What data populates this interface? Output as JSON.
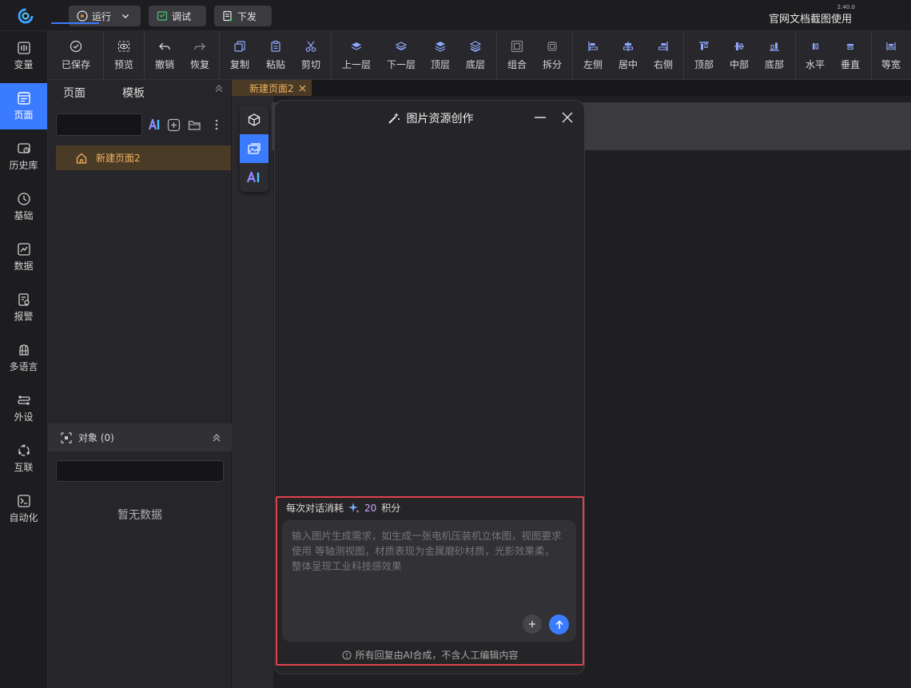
{
  "topbar": {
    "run_label": "运行",
    "debug_label": "调试",
    "deploy_label": "下发",
    "version": "2.40.0",
    "doc_title": "官网文档截图使用"
  },
  "leftnav": {
    "items": [
      {
        "label": "变量",
        "icon": "variable-icon"
      },
      {
        "label": "页面",
        "icon": "page-icon",
        "active": true
      },
      {
        "label": "历史库",
        "icon": "history-icon"
      },
      {
        "label": "基础",
        "icon": "basic-icon"
      },
      {
        "label": "数据",
        "icon": "data-icon"
      },
      {
        "label": "报警",
        "icon": "alarm-icon"
      },
      {
        "label": "多语言",
        "icon": "language-icon"
      },
      {
        "label": "外设",
        "icon": "peripheral-icon"
      },
      {
        "label": "互联",
        "icon": "connect-icon"
      },
      {
        "label": "自动化",
        "icon": "automation-icon"
      }
    ]
  },
  "toolbar": {
    "items": [
      {
        "label": "已保存",
        "icon": "saved-icon"
      },
      {
        "label": "预览",
        "icon": "preview-icon"
      },
      {
        "label": "撤销",
        "icon": "undo-icon"
      },
      {
        "label": "恢复",
        "icon": "redo-icon"
      },
      {
        "label": "复制",
        "icon": "copy-icon"
      },
      {
        "label": "粘贴",
        "icon": "paste-icon"
      },
      {
        "label": "剪切",
        "icon": "cut-icon"
      },
      {
        "label": "上一层",
        "icon": "layer-up-icon"
      },
      {
        "label": "下一层",
        "icon": "layer-down-icon"
      },
      {
        "label": "顶层",
        "icon": "layer-top-icon"
      },
      {
        "label": "底层",
        "icon": "layer-bottom-icon"
      },
      {
        "label": "组合",
        "icon": "group-icon"
      },
      {
        "label": "拆分",
        "icon": "ungroup-icon"
      },
      {
        "label": "左侧",
        "icon": "align-left-icon"
      },
      {
        "label": "居中",
        "icon": "align-center-icon"
      },
      {
        "label": "右侧",
        "icon": "align-right-icon"
      },
      {
        "label": "顶部",
        "icon": "align-top-icon"
      },
      {
        "label": "中部",
        "icon": "align-middle-icon"
      },
      {
        "label": "底部",
        "icon": "align-bottom-icon"
      },
      {
        "label": "水平",
        "icon": "distribute-h-icon"
      },
      {
        "label": "垂直",
        "icon": "distribute-v-icon"
      },
      {
        "label": "等宽",
        "icon": "equal-width-icon"
      }
    ]
  },
  "pagepanel": {
    "tab_pages": "页面",
    "tab_templates": "模板",
    "page_name": "新建页面2",
    "objects_header": "对象 (0)",
    "no_data": "暂无数据"
  },
  "editor": {
    "doc_tab": "新建页面2"
  },
  "dialog": {
    "title": "图片资源创作",
    "cost_prefix": "每次对话消耗",
    "cost_value": "20",
    "cost_unit": "积分",
    "prompt_placeholder": "输入图片生成需求，如生成一张电机压装机立体图，视图要求使用 等轴测视图，材质表现为金属磨砂材质，光影效果柔， 整体呈现工业科技感效果",
    "disclaimer": "所有回复由AI合成，不含人工编辑内容"
  },
  "colors": {
    "accent": "#3b7bff",
    "active_page": "#f0b060",
    "highlight_border": "#e0414f"
  }
}
